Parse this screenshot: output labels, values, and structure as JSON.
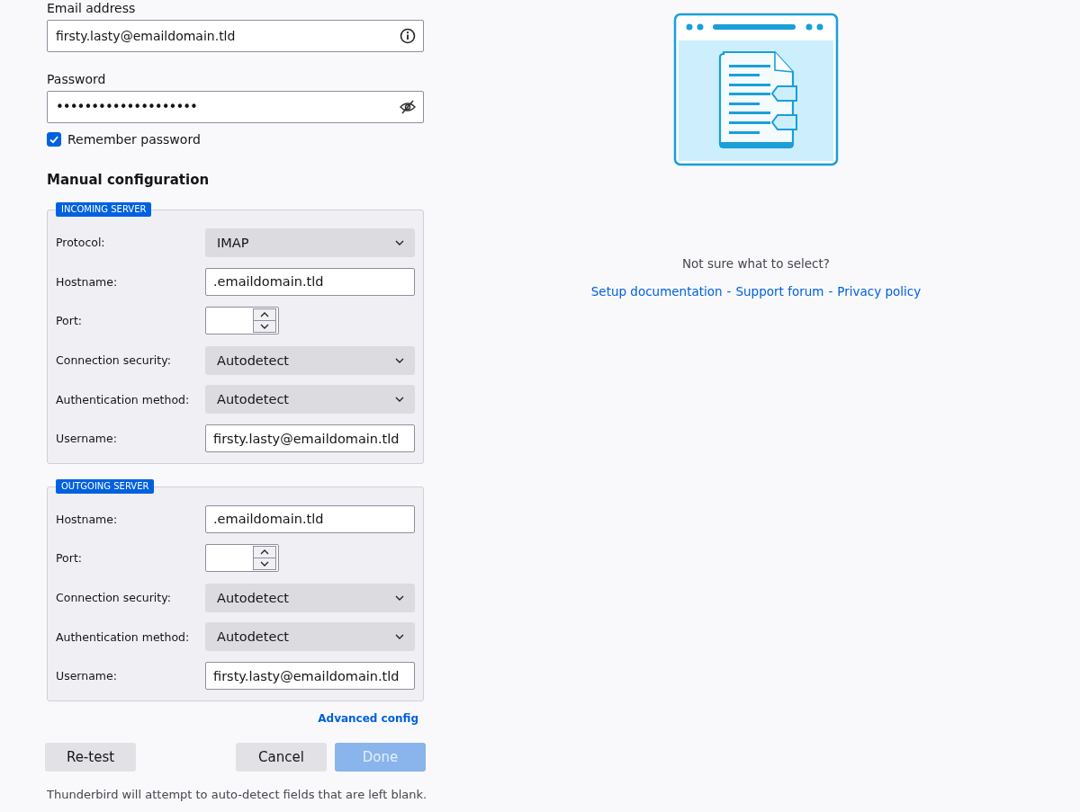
{
  "email": {
    "label": "Email address",
    "value": "firsty.lasty@emaildomain.tld"
  },
  "password": {
    "label": "Password",
    "value": "••••••••••••••••••••"
  },
  "remember": {
    "label": "Remember password",
    "checked": true
  },
  "manual": {
    "title": "Manual configuration"
  },
  "servers": [
    {
      "legend": "INCOMING SERVER",
      "rows": [
        {
          "kind": "select",
          "label": "Protocol:",
          "value": "IMAP"
        },
        {
          "kind": "text",
          "label": "Hostname:",
          "value": ".emaildomain.tld"
        },
        {
          "kind": "port",
          "label": "Port:"
        },
        {
          "kind": "select",
          "label": "Connection security:",
          "value": "Autodetect"
        },
        {
          "kind": "select",
          "label": "Authentication method:",
          "value": "Autodetect"
        },
        {
          "kind": "text",
          "label": "Username:",
          "value": "firsty.lasty@emaildomain.tld"
        }
      ]
    },
    {
      "legend": "OUTGOING SERVER",
      "rows": [
        {
          "kind": "text",
          "label": "Hostname:",
          "value": ".emaildomain.tld"
        },
        {
          "kind": "port",
          "label": "Port:"
        },
        {
          "kind": "select",
          "label": "Connection security:",
          "value": "Autodetect"
        },
        {
          "kind": "select",
          "label": "Authentication method:",
          "value": "Autodetect"
        },
        {
          "kind": "text",
          "label": "Username:",
          "value": "firsty.lasty@emaildomain.tld"
        }
      ]
    }
  ],
  "advanced_link": "Advanced config",
  "buttons": [
    {
      "label": "Re-test",
      "kind": "secondary",
      "disabled": false
    },
    {
      "label": "Cancel",
      "kind": "secondary",
      "disabled": false
    },
    {
      "label": "Done",
      "kind": "primary",
      "disabled": true
    }
  ],
  "footnote": "Thunderbird will attempt to auto-detect fields that are left blank.",
  "help": {
    "question": "Not sure what to select?",
    "links": [
      {
        "label": "Setup documentation"
      },
      {
        "label": "Support forum"
      },
      {
        "label": "Privacy policy"
      }
    ],
    "separator": "-"
  }
}
